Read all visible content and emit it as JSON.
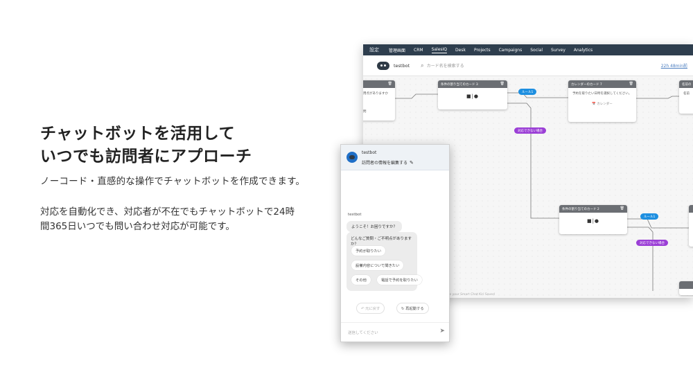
{
  "hero": {
    "title_line1": "チャットボットを活用して",
    "title_line2": "いつでも訪問者にアプローチ",
    "subtitle": "ノーコード・直感的な操作でチャットボットを作成できます。",
    "desc_line1": "対応を自動化でき、対応者が不在でもチャットボットで24時",
    "desc_line2": "間365日いつでも問い合わせ対応が可能です。"
  },
  "topnav": {
    "items": [
      "設定",
      "管理画面",
      "CRM",
      "SalesIQ",
      "Desk",
      "Projects",
      "Campaigns",
      "Social",
      "Survey",
      "Analytics"
    ],
    "active": "SalesIQ"
  },
  "subbar": {
    "bot_name": "testbot",
    "search_placeholder": "カード名を検索する",
    "timer": "22h 48min前"
  },
  "cards": {
    "c1": {
      "title": "",
      "line1": "用点がありますか",
      "line2": "",
      "side": "問"
    },
    "c2": {
      "title": "条件の割り当てのカード 3",
      "glyph": "■|●"
    },
    "c3": {
      "title": "カレンダーのカード 7",
      "body": "予約を取りたい日時を選択してください。",
      "cal": "カレンダー"
    },
    "c4": {
      "title": "名前の",
      "body": "名前"
    },
    "c5": {
      "title": "条件の割り当てのカード 2",
      "glyph": "■|●"
    },
    "c6": {
      "title": ""
    }
  },
  "pills": {
    "rule1a": "ルール1",
    "else1": "対応できない場合",
    "rule1b": "ルール1",
    "else2": "対応できない場合"
  },
  "builder_footer": "ns your Smart Chat Kiri Saved",
  "chat": {
    "bot_name": "testbot",
    "edit_label": "訪問者の情報を編集する",
    "sender": "testbot",
    "greeting": "ようこそ！お困りですか？",
    "question": "どんなご質問・ご不明点がありますか？",
    "options": [
      "予約が取りたい",
      "設備内容について聞きたい",
      "その他",
      "電話で予約を取りたい"
    ],
    "back_label": "元に戻す",
    "restart_label": "再起動する",
    "input_placeholder": "送信してください"
  }
}
